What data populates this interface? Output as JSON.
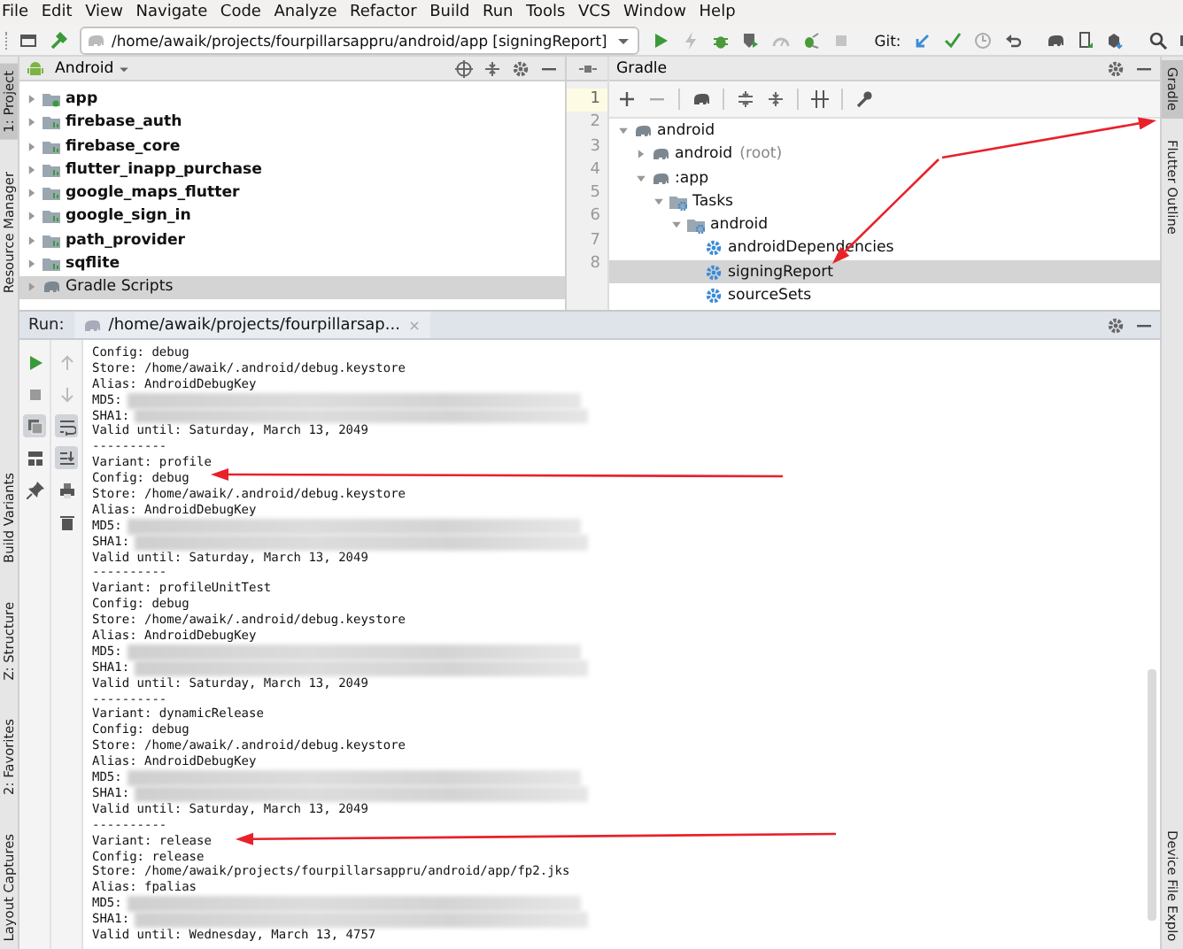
{
  "menu": [
    "File",
    "Edit",
    "View",
    "Navigate",
    "Code",
    "Analyze",
    "Refactor",
    "Build",
    "Run",
    "Tools",
    "VCS",
    "Window",
    "Help"
  ],
  "toolbar": {
    "run_config": "/home/awaik/projects/fourpillarsappru/android/app [signingReport]",
    "vcs_label": "Git:"
  },
  "left_tool_strip": {
    "top": [
      {
        "label": "1: Project",
        "selected": true
      },
      {
        "label": "Resource Manager",
        "selected": false
      }
    ],
    "bottom": [
      {
        "label": "Build Variants",
        "selected": false
      },
      {
        "label": "Z: Structure",
        "selected": false
      },
      {
        "label": "2: Favorites",
        "selected": false
      },
      {
        "label": "Layout Captures",
        "selected": false
      }
    ]
  },
  "right_tool_strip": {
    "top": [
      {
        "label": "Gradle",
        "selected": true
      },
      {
        "label": "Flutter Outline",
        "selected": false
      }
    ],
    "bottom": [
      {
        "label": "Device File Explo",
        "selected": false
      }
    ]
  },
  "project_panel": {
    "view": "Android",
    "items": [
      {
        "label": "app",
        "kind": "app",
        "expanded": false,
        "selected": false
      },
      {
        "label": "firebase_auth",
        "kind": "module",
        "expanded": false,
        "selected": false
      },
      {
        "label": "firebase_core",
        "kind": "module",
        "expanded": false,
        "selected": false
      },
      {
        "label": "flutter_inapp_purchase",
        "kind": "module",
        "expanded": false,
        "selected": false
      },
      {
        "label": "google_maps_flutter",
        "kind": "module",
        "expanded": false,
        "selected": false
      },
      {
        "label": "google_sign_in",
        "kind": "module",
        "expanded": false,
        "selected": false
      },
      {
        "label": "path_provider",
        "kind": "module",
        "expanded": false,
        "selected": false
      },
      {
        "label": "sqflite",
        "kind": "module",
        "expanded": false,
        "selected": false
      },
      {
        "label": "Gradle Scripts",
        "kind": "scripts",
        "expanded": false,
        "selected": true
      }
    ]
  },
  "editor_gutter": {
    "line_numbers": [
      {
        "number": "1",
        "current": true
      },
      {
        "number": "2",
        "current": false
      },
      {
        "number": "3",
        "current": false
      },
      {
        "number": "4",
        "current": false
      },
      {
        "number": "5",
        "current": false
      },
      {
        "number": "6",
        "current": false
      },
      {
        "number": "7",
        "current": false
      },
      {
        "number": "8",
        "current": false
      }
    ]
  },
  "gradle_panel": {
    "title": "Gradle",
    "tree": [
      {
        "label": "android",
        "kind": "project",
        "expanded": true,
        "selected": false,
        "children": [
          {
            "label": "android",
            "note": "(root)",
            "kind": "project",
            "expanded": false,
            "selected": false
          },
          {
            "label": ":app",
            "kind": "project",
            "expanded": true,
            "selected": false,
            "children": [
              {
                "label": "Tasks",
                "kind": "folder",
                "expanded": true,
                "selected": false,
                "children": [
                  {
                    "label": "android",
                    "kind": "folder",
                    "expanded": true,
                    "selected": false,
                    "children": [
                      {
                        "label": "androidDependencies",
                        "kind": "task",
                        "selected": false
                      },
                      {
                        "label": "signingReport",
                        "kind": "task",
                        "selected": true
                      },
                      {
                        "label": "sourceSets",
                        "kind": "task",
                        "selected": false
                      }
                    ]
                  }
                ]
              }
            ]
          }
        ]
      }
    ]
  },
  "run_panel": {
    "label": "Run:",
    "tab": "/home/awaik/projects/fourpillarsap...",
    "side_buttons": [
      [
        {
          "kind": "run",
          "on": false
        },
        {
          "kind": "stop",
          "on": false
        },
        {
          "kind": "restore_layout",
          "on": true
        },
        {
          "kind": "layout",
          "on": false
        },
        {
          "kind": "pin",
          "on": false
        }
      ],
      [
        {
          "kind": "up",
          "on": false
        },
        {
          "kind": "down",
          "on": false
        },
        {
          "kind": "soft_wrap",
          "on": true
        },
        {
          "kind": "scroll_end",
          "on": true
        },
        {
          "kind": "print",
          "on": false
        },
        {
          "kind": "trash",
          "on": false
        }
      ]
    ],
    "lines": [
      {
        "text": "Config: debug",
        "kind": "plain"
      },
      {
        "text": "Store: /home/awaik/.android/debug.keystore",
        "kind": "plain"
      },
      {
        "text": "Alias: AndroidDebugKey",
        "kind": "plain"
      },
      {
        "text": "MD5:",
        "kind": "hash"
      },
      {
        "text": "SHA1:",
        "kind": "hash"
      },
      {
        "text": "Valid until: Saturday, March 13, 2049",
        "kind": "plain"
      },
      {
        "text": "----------",
        "kind": "plain"
      },
      {
        "text": "Variant: profile",
        "kind": "plain"
      },
      {
        "text": "Config: debug",
        "kind": "plain"
      },
      {
        "text": "Store: /home/awaik/.android/debug.keystore",
        "kind": "plain"
      },
      {
        "text": "Alias: AndroidDebugKey",
        "kind": "plain"
      },
      {
        "text": "MD5:",
        "kind": "hash"
      },
      {
        "text": "SHA1:",
        "kind": "hash"
      },
      {
        "text": "Valid until: Saturday, March 13, 2049",
        "kind": "plain"
      },
      {
        "text": "----------",
        "kind": "plain"
      },
      {
        "text": "Variant: profileUnitTest",
        "kind": "plain"
      },
      {
        "text": "Config: debug",
        "kind": "plain"
      },
      {
        "text": "Store: /home/awaik/.android/debug.keystore",
        "kind": "plain"
      },
      {
        "text": "Alias: AndroidDebugKey",
        "kind": "plain"
      },
      {
        "text": "MD5:",
        "kind": "hash"
      },
      {
        "text": "SHA1:",
        "kind": "hash"
      },
      {
        "text": "Valid until: Saturday, March 13, 2049",
        "kind": "plain"
      },
      {
        "text": "----------",
        "kind": "plain"
      },
      {
        "text": "Variant: dynamicRelease",
        "kind": "plain"
      },
      {
        "text": "Config: debug",
        "kind": "plain"
      },
      {
        "text": "Store: /home/awaik/.android/debug.keystore",
        "kind": "plain"
      },
      {
        "text": "Alias: AndroidDebugKey",
        "kind": "plain"
      },
      {
        "text": "MD5:",
        "kind": "hash"
      },
      {
        "text": "SHA1:",
        "kind": "hash"
      },
      {
        "text": "Valid until: Saturday, March 13, 2049",
        "kind": "plain"
      },
      {
        "text": "----------",
        "kind": "plain"
      },
      {
        "text": "Variant: release",
        "kind": "plain"
      },
      {
        "text": "Config: release",
        "kind": "plain"
      },
      {
        "text": "Store: /home/awaik/projects/fourpillarsappru/android/app/fp2.jks",
        "kind": "plain"
      },
      {
        "text": "Alias: fpalias",
        "kind": "plain"
      },
      {
        "text": "MD5:",
        "kind": "hash"
      },
      {
        "text": "SHA1:",
        "kind": "hash"
      },
      {
        "text": "Valid until: Wednesday, March 13, 4757",
        "kind": "plain"
      }
    ]
  }
}
